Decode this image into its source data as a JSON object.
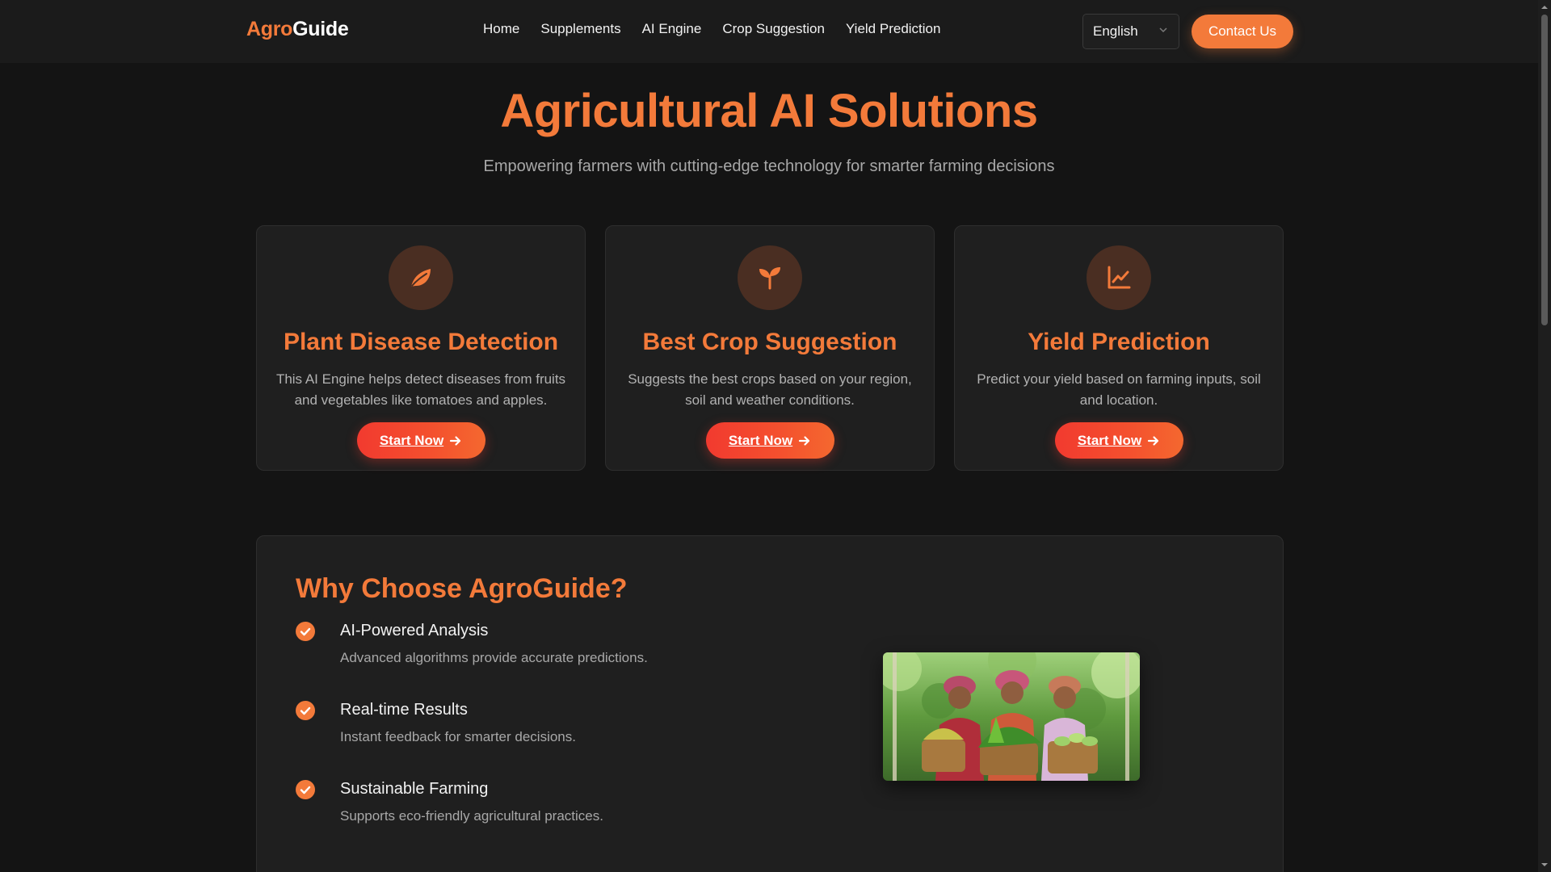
{
  "nav": {
    "logo_part1": "Agro",
    "logo_part2": "Guide",
    "links": [
      "Home",
      "Supplements",
      "AI Engine",
      "Crop Suggestion",
      "Yield Prediction"
    ],
    "language": "English",
    "contact_label": "Contact Us"
  },
  "hero": {
    "title": "Agricultural AI Solutions",
    "subtitle": "Empowering farmers with cutting-edge technology for smarter farming decisions"
  },
  "cards": [
    {
      "icon": "leaf-icon",
      "title": "Plant Disease Detection",
      "desc": "This AI Engine helps detect diseases from fruits and vegetables like tomatoes and apples.",
      "button": "Start Now"
    },
    {
      "icon": "seedling-icon",
      "title": "Best Crop Suggestion",
      "desc": "Suggests the best crops based on your region, soil and weather conditions.",
      "button": "Start Now"
    },
    {
      "icon": "chart-line-icon",
      "title": "Yield Prediction",
      "desc": "Predict your yield based on farming inputs, soil and location.",
      "button": "Start Now"
    }
  ],
  "why": {
    "title": "Why Choose AgroGuide?",
    "features": [
      {
        "title": "AI-Powered Analysis",
        "desc": "Advanced algorithms provide accurate predictions."
      },
      {
        "title": "Real-time Results",
        "desc": "Instant feedback for smarter decisions."
      },
      {
        "title": "Sustainable Farming",
        "desc": "Supports eco-friendly agricultural practices."
      }
    ]
  },
  "colors": {
    "accent": "#f37a3a",
    "button_red": "#f23a2f",
    "background": "#141414",
    "card": "#1f1f1f"
  }
}
